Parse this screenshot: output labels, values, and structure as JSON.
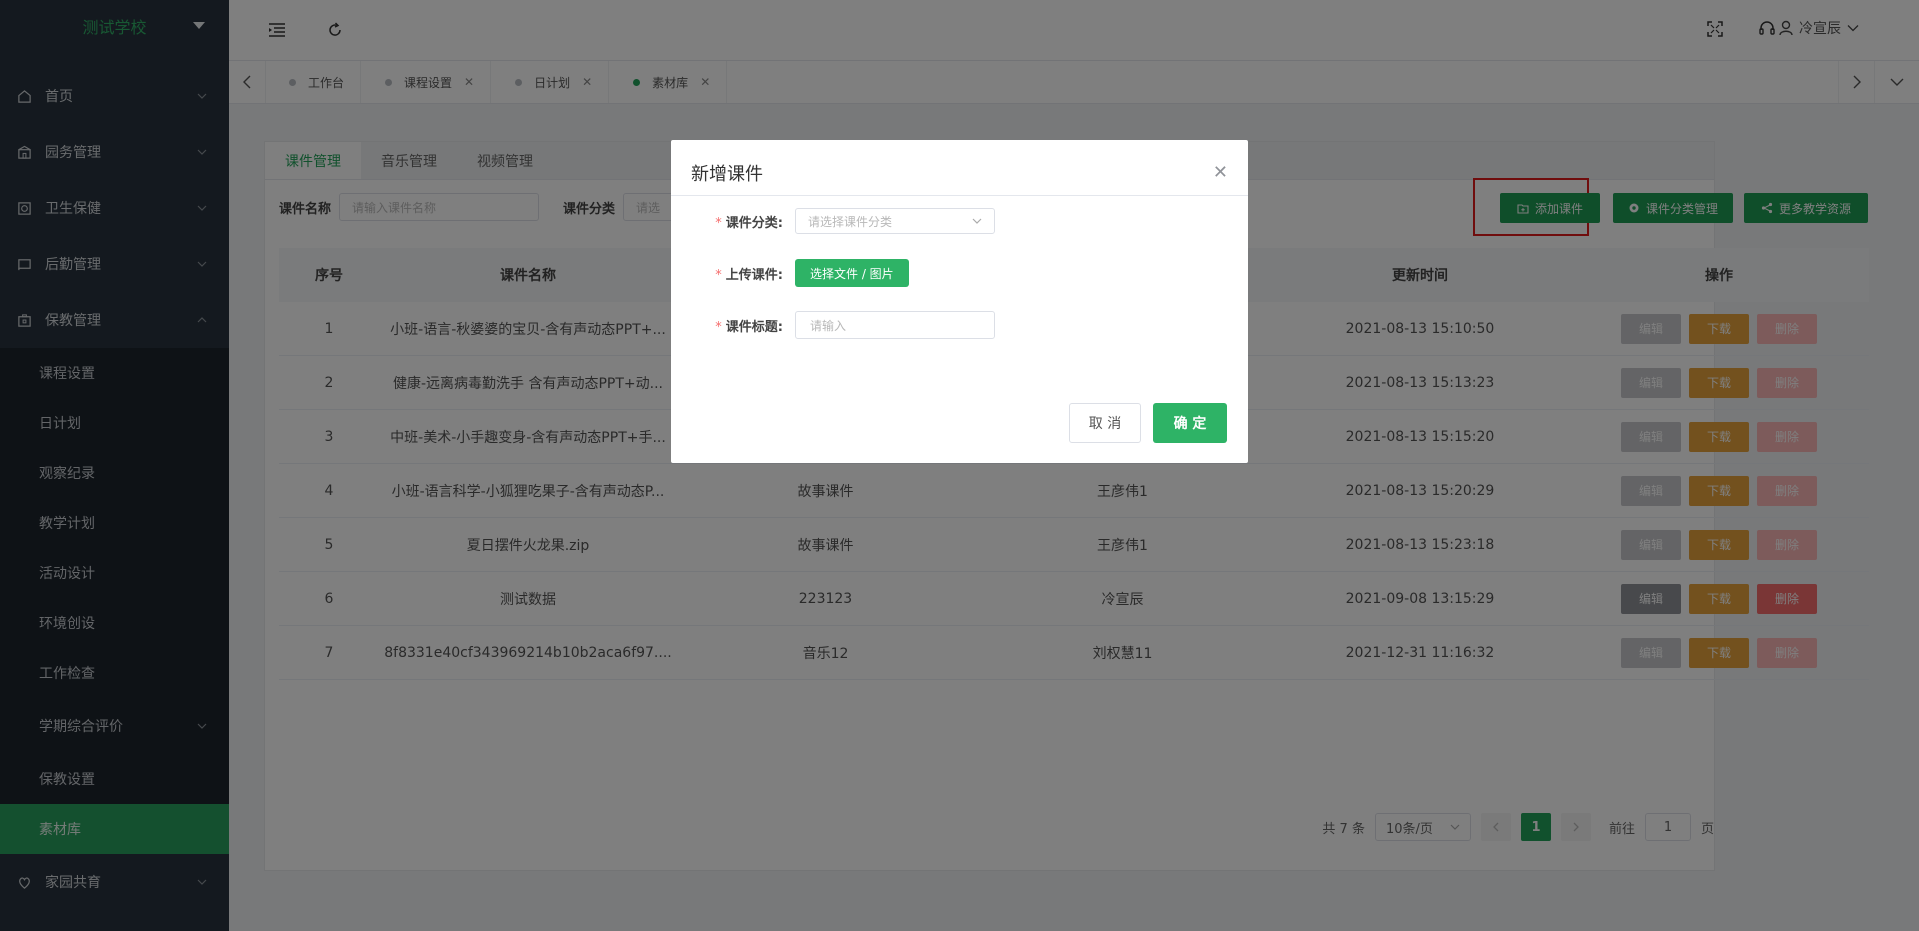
{
  "app": {
    "school": "测试学校"
  },
  "sidebar": {
    "items": [
      {
        "label": "首页",
        "icon": "home-icon"
      },
      {
        "label": "园务管理",
        "icon": "building-icon"
      },
      {
        "label": "卫生保健",
        "icon": "health-icon"
      },
      {
        "label": "后勤管理",
        "icon": "logistics-icon"
      },
      {
        "label": "保教管理",
        "icon": "case-icon"
      }
    ],
    "subitems": [
      "课程设置",
      "日计划",
      "观察纪录",
      "教学计划",
      "活动设计",
      "环境创设",
      "工作检查",
      "学期综合评价",
      "保教设置",
      "素材库"
    ],
    "active": "素材库",
    "footer_item": {
      "label": "家园共育",
      "icon": "heart-icon"
    }
  },
  "header": {
    "user": "冷宣辰"
  },
  "tabs": [
    {
      "label": "工作台",
      "closable": false
    },
    {
      "label": "课程设置",
      "closable": true
    },
    {
      "label": "日计划",
      "closable": true
    },
    {
      "label": "素材库",
      "closable": true,
      "active": true
    }
  ],
  "content": {
    "tabs": [
      "课件管理",
      "音乐管理",
      "视频管理"
    ],
    "filters": {
      "name_label": "课件名称",
      "name_placeholder": "请输入课件名称",
      "category_label": "课件分类",
      "category_placeholder": "请选"
    },
    "buttons": {
      "add": "添加课件",
      "category": "课件分类管理",
      "more": "更多教学资源"
    },
    "table": {
      "headers": [
        "序号",
        "课件名称",
        "",
        "",
        "更新时间",
        "操作"
      ],
      "rows": [
        {
          "idx": "1",
          "name": "小班-语言-秋婆婆的宝贝-含有声动态PPT+...",
          "category": "",
          "author": "",
          "time": "2021-08-13 15:10:50",
          "editable": false
        },
        {
          "idx": "2",
          "name": "健康-远离病毒勤洗手 含有声动态PPT+动...",
          "category": "",
          "author": "",
          "time": "2021-08-13 15:13:23",
          "editable": false
        },
        {
          "idx": "3",
          "name": "中班-美术-小手趣变身-含有声动态PPT+手...",
          "category": "",
          "author": "",
          "time": "2021-08-13 15:15:20",
          "editable": false
        },
        {
          "idx": "4",
          "name": "小班-语言科学-小狐狸吃果子-含有声动态P...",
          "category": "故事课件",
          "author": "王彦伟1",
          "time": "2021-08-13 15:20:29",
          "editable": false
        },
        {
          "idx": "5",
          "name": "夏日摆件火龙果.zip",
          "category": "故事课件",
          "author": "王彦伟1",
          "time": "2021-08-13 15:23:18",
          "editable": false
        },
        {
          "idx": "6",
          "name": "测试数据",
          "category": "223123",
          "author": "冷宣辰",
          "time": "2021-09-08 13:15:29",
          "editable": true
        },
        {
          "idx": "7",
          "name": "8f8331e40cf343969214b10b2aca6f97....",
          "category": "音乐12",
          "author": "刘权慧11",
          "time": "2021-12-31 11:16:32",
          "editable": false
        }
      ],
      "ops": {
        "edit": "编辑",
        "download": "下载",
        "delete": "删除"
      }
    },
    "pagination": {
      "total": "共 7 条",
      "page_size": "10条/页",
      "current": "1",
      "goto_label": "前往",
      "goto_value": "1",
      "page_unit": "页"
    }
  },
  "modal": {
    "title": "新增课件",
    "fields": {
      "category_label": "课件分类:",
      "category_placeholder": "请选择课件分类",
      "upload_label": "上传课件:",
      "upload_button": "选择文件 / 图片",
      "title_label": "课件标题:",
      "title_placeholder": "请输入"
    },
    "cancel": "取 消",
    "ok": "确 定"
  },
  "colors": {
    "primary": "#22a35a",
    "sidebar": "#28333e",
    "highlight": "#e11b1b"
  }
}
